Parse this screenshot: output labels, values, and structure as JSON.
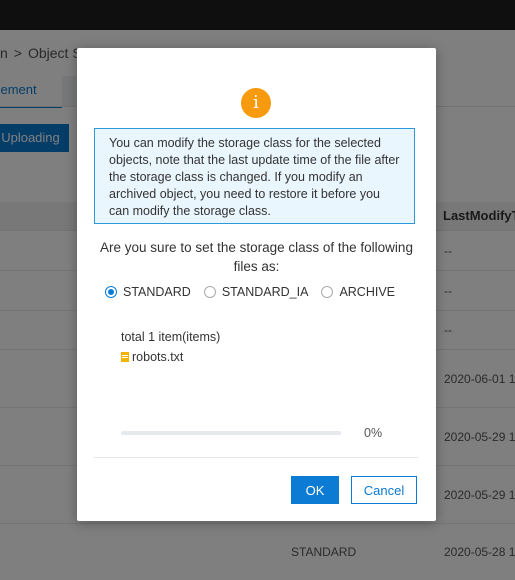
{
  "background": {
    "breadcrumb": [
      "n",
      "Object S"
    ],
    "breadcrumb_sep": ">",
    "tab_active": "agement",
    "upload_button": "Uploading",
    "column_header": "LastModifyT",
    "rows": [
      {
        "storage_class": "",
        "last_modify": "--"
      },
      {
        "storage_class": "",
        "last_modify": "--"
      },
      {
        "storage_class": "",
        "last_modify": "--"
      },
      {
        "storage_class": "",
        "last_modify": "2020-06-01 1"
      },
      {
        "storage_class": "",
        "last_modify": "2020-05-29 1"
      },
      {
        "storage_class": "",
        "last_modify": "2020-05-29 1"
      },
      {
        "storage_class": "STANDARD",
        "last_modify": "2020-05-28 1"
      }
    ]
  },
  "dialog": {
    "icon": "info-icon",
    "icon_glyph": "i",
    "notice": "You can modify the storage class for the selected objects, note that the last update time of the file after the storage class is changed. If you modify an archived object, you need to restore it before you can modify the storage class.",
    "question": "Are you sure to set the storage class of the following files as:",
    "options": [
      {
        "label": "STANDARD",
        "checked": true
      },
      {
        "label": "STANDARD_IA",
        "checked": false
      },
      {
        "label": "ARCHIVE",
        "checked": false
      }
    ],
    "total": "total 1 item(items)",
    "file_name": "robots.txt",
    "progress_percent": 0,
    "progress_text": "0%",
    "ok_label": "OK",
    "cancel_label": "Cancel"
  },
  "colors": {
    "accent": "#0b7bd3",
    "warning": "#f79a0d",
    "notice_bg": "#eaf6fd"
  }
}
